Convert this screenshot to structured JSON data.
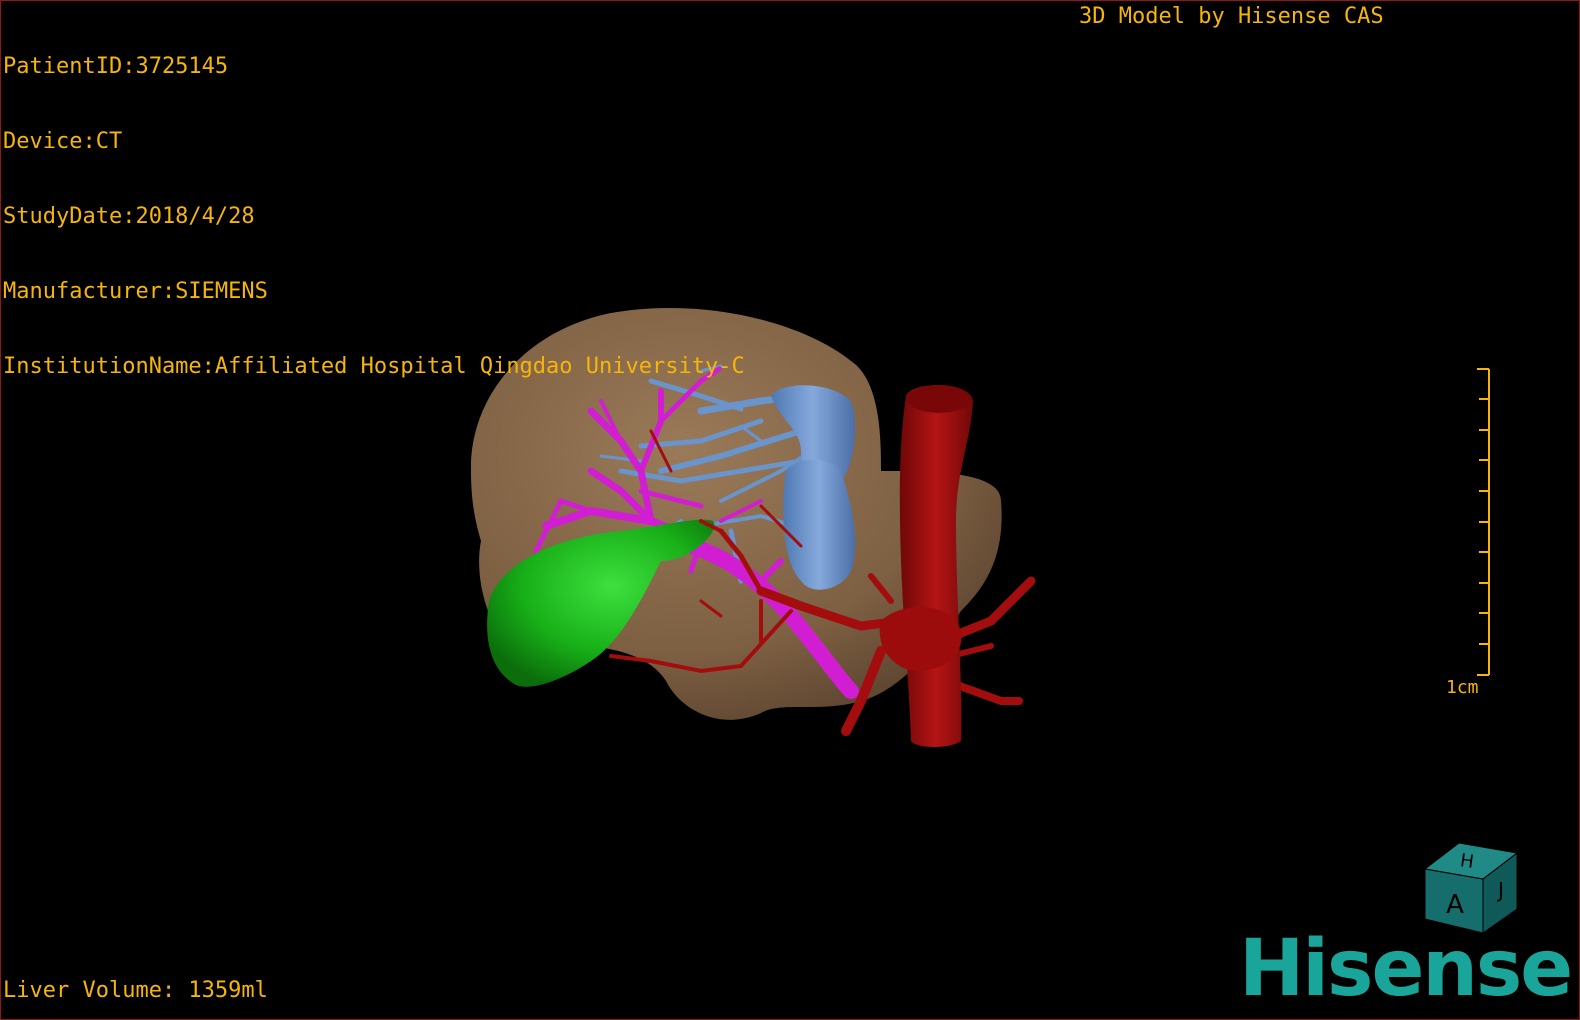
{
  "header": {
    "patient_id": "PatientID:3725145",
    "device": "Device:CT",
    "study_date": "StudyDate:2018/4/28",
    "manufacturer": "Manufacturer:SIEMENS",
    "institution": "InstitutionName:Affiliated Hospital Qingdao University-C"
  },
  "title": "3D Model by Hisense CAS",
  "footer": {
    "liver_volume": "Liver Volume: 1359ml"
  },
  "scale_bar": {
    "unit_label": "1cm"
  },
  "orientation_cube": {
    "labels": [
      "H",
      "A",
      "J"
    ]
  },
  "brand": {
    "logo_text": "Hisense"
  },
  "colors": {
    "overlay_text": "#f5b50a",
    "liver": "#8a6a4a",
    "gallbladder": "#1fb81f",
    "hepatic_vein": "#6a94cc",
    "portal_vein": "#d21ed2",
    "artery": "#a40d0d",
    "brand": "#1aa59a",
    "border": "#8b1a1a"
  }
}
